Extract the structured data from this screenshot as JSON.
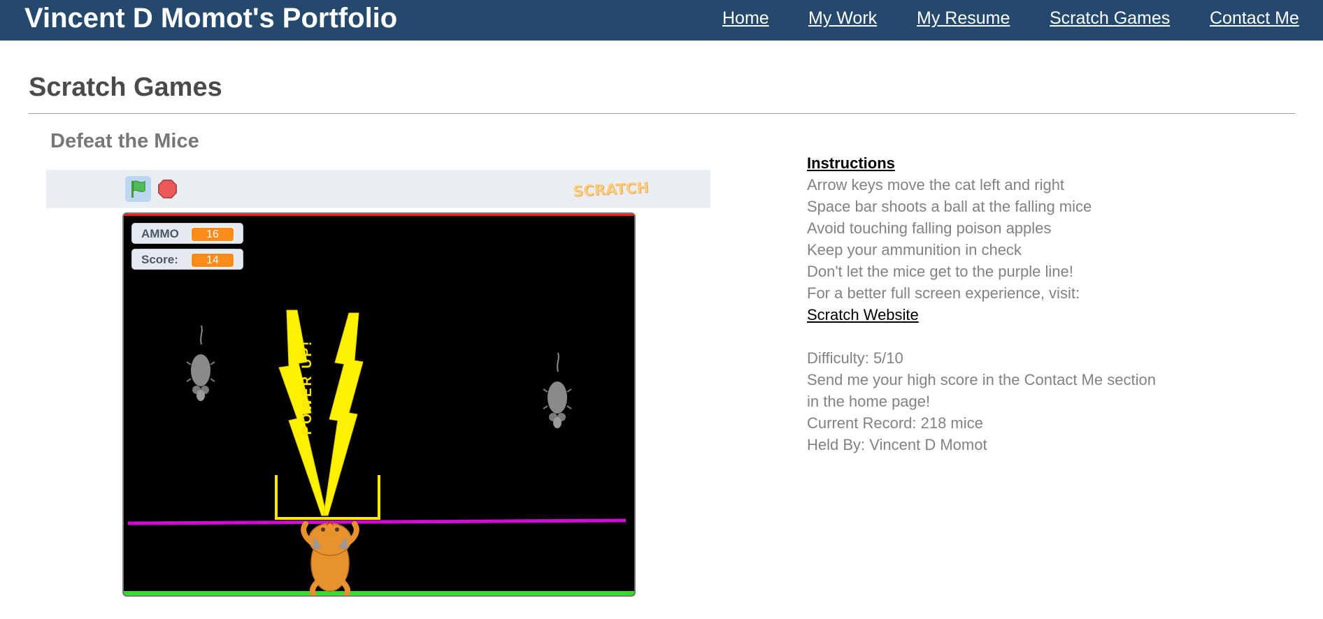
{
  "header": {
    "brand": "Vincent D Momot's Portfolio",
    "nav": [
      "Home",
      "My Work",
      "My Resume",
      "Scratch Games",
      "Contact Me"
    ],
    "background_color": "#24496c"
  },
  "page": {
    "title": "Scratch Games",
    "game_title": "Defeat the Mice"
  },
  "player": {
    "logo_text": "SCRATCH",
    "monitors": [
      {
        "label": "AMMO",
        "value": "16"
      },
      {
        "label": "Score:",
        "value": "14"
      }
    ],
    "stage_text": "POWER UP!",
    "icons": [
      "green-flag-icon",
      "stop-sign-icon"
    ]
  },
  "instructions": {
    "heading": "Instructions",
    "lines": [
      "Arrow keys move the cat left and right",
      "Space bar shoots a ball at the falling mice",
      "Avoid touching falling poison apples",
      "Keep your ammunition in check",
      "Don't let the mice get to the purple line!",
      "For a better full screen experience, visit:"
    ],
    "link_text": "Scratch Website",
    "details": [
      "Difficulty: 5/10",
      "Send me your high score in the Contact Me section",
      "in the home page!",
      "Current Record: 218 mice",
      "Held By: Vincent D Momot"
    ]
  }
}
